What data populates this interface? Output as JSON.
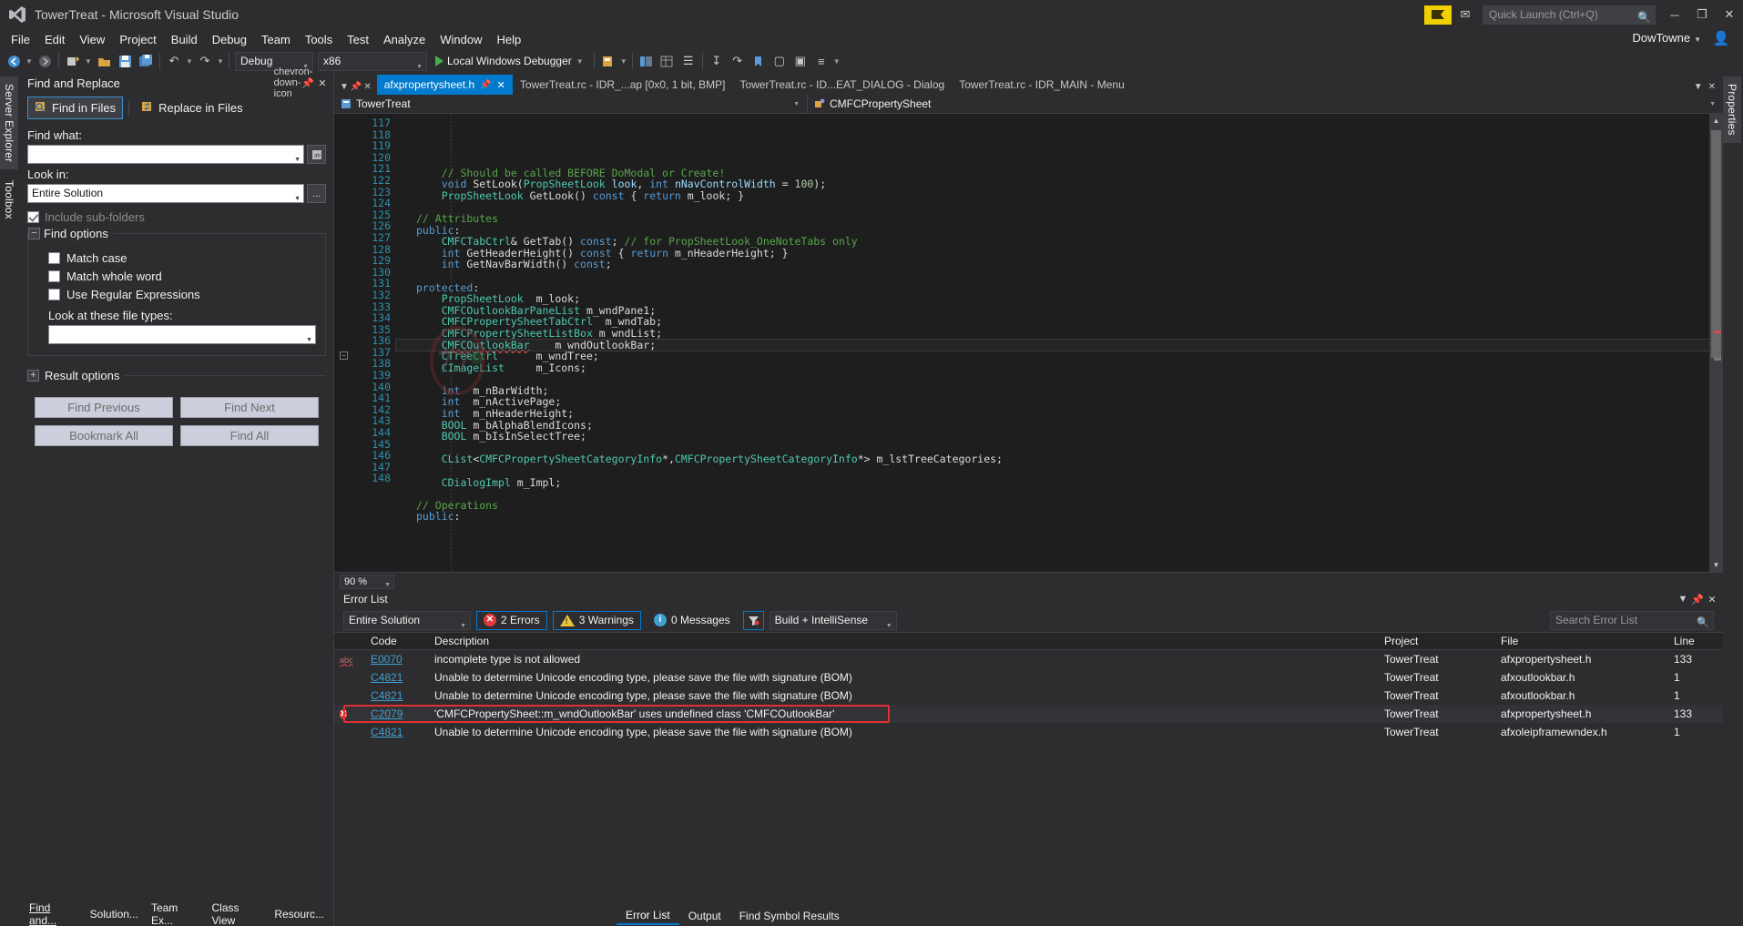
{
  "window": {
    "title": "TowerTreat - Microsoft Visual Studio",
    "logo_icon": "visual-studio-logo",
    "minimize_label": "─",
    "maximize_label": "❐",
    "close_label": "✕",
    "feedback_icon": "feedback-icon",
    "flag_icon": "flag-icon"
  },
  "quick_launch": {
    "placeholder": "Quick Launch (Ctrl+Q)",
    "icon": "search-icon"
  },
  "menu": {
    "items": [
      "File",
      "Edit",
      "View",
      "Project",
      "Build",
      "Debug",
      "Team",
      "Tools",
      "Test",
      "Analyze",
      "Window",
      "Help"
    ],
    "account": "DowTowne",
    "account_icon": "user-account-icon"
  },
  "toolbar": {
    "nav_back_icon": "navigate-back-icon",
    "nav_forward_icon": "navigate-forward-icon",
    "new_project_icon": "new-project-icon",
    "open_file_icon": "open-file-icon",
    "save_icon": "save-icon",
    "save_all_icon": "save-all-icon",
    "undo_icon": "undo-icon",
    "redo_icon": "redo-icon",
    "config": "Debug",
    "platform": "x86",
    "run_label": "Local Windows Debugger",
    "run_icon": "play-icon",
    "extra_icons": [
      "attach-icon",
      "solution-explorer-icon",
      "properties-icon",
      "toolbox-icon",
      "step-into-icon",
      "step-over-icon",
      "bookmark-icon",
      "comment-icon",
      "uncomment-icon",
      "indent-icon"
    ]
  },
  "left_rail": {
    "tabs": [
      "Server Explorer",
      "Toolbox"
    ]
  },
  "right_rail": {
    "tabs": [
      "Properties"
    ]
  },
  "find_replace": {
    "title": "Find and Replace",
    "pin_icon": "pin-icon",
    "close_icon": "close-icon",
    "chevron_icon": "chevron-down-icon",
    "tabs": [
      {
        "label": "Find in Files",
        "icon": "find-in-files-icon",
        "active": true
      },
      {
        "label": "Replace in Files",
        "icon": "replace-in-files-icon",
        "active": false
      }
    ],
    "find_what_label": "Find what:",
    "find_what_value": "",
    "find_what_button_icon": "regex-builder-icon",
    "look_in_label": "Look in:",
    "look_in_value": "Entire Solution",
    "look_in_browse": "...",
    "include_subfolders_label": "Include sub-folders",
    "include_subfolders_checked": true,
    "find_options_title": "Find options",
    "find_options_expander": "−",
    "options": [
      {
        "label": "Match case",
        "checked": false
      },
      {
        "label": "Match whole word",
        "checked": false
      },
      {
        "label": "Use Regular Expressions",
        "checked": false
      }
    ],
    "file_types_label": "Look at these file types:",
    "file_types_value": "",
    "result_options_title": "Result options",
    "result_options_expander": "+",
    "buttons": [
      "Find Previous",
      "Find Next",
      "Bookmark All",
      "Find All"
    ]
  },
  "footer_tabs": [
    "Find and...",
    "Solution...",
    "Team Ex...",
    "Class View",
    "Resourc..."
  ],
  "editor": {
    "tabs": [
      {
        "label": "afxpropertysheet.h",
        "active": true,
        "pin_icon": "pin-icon",
        "close_icon": "close-icon"
      },
      {
        "label": "TowerTreat.rc - IDR_...ap [0x0, 1 bit, BMP]",
        "active": false
      },
      {
        "label": "TowerTreat.rc - ID...EAT_DIALOG - Dialog",
        "active": false
      },
      {
        "label": "TowerTreat.rc - IDR_MAIN - Menu",
        "active": false
      }
    ],
    "tabstrip_left_icons": [
      "chevron-down-icon",
      "pin-icon",
      "close-icon"
    ],
    "tabstrip_right_icons": [
      "chevron-down-icon",
      "close-icon"
    ],
    "nav_left": {
      "label": "TowerTreat",
      "icon": "project-icon"
    },
    "nav_right": {
      "label": "CMFCPropertySheet",
      "icon": "class-icon"
    },
    "zoom": "90 %",
    "first_line": 117,
    "code_lines": [
      {
        "n": 117,
        "text": ""
      },
      {
        "n": 118,
        "text": "    // Should be called BEFORE DoModal or Create!",
        "cls": "cm"
      },
      {
        "n": 119,
        "html": "    <span class=\"kw\">void</span> SetLook(<span class=\"kw2\">PropSheetLook</span> <span class=\"id\">look</span>, <span class=\"kw\">int</span> <span class=\"id\">nNavControlWidth</span> = <span class=\"num\">100</span>);"
      },
      {
        "n": 120,
        "html": "    <span class=\"kw2\">PropSheetLook</span> GetLook() <span class=\"kw\">const</span> { <span class=\"kw\">return</span> m_look; }"
      },
      {
        "n": 121,
        "text": ""
      },
      {
        "n": 122,
        "html": "<span class=\"cm\">// Attributes</span>"
      },
      {
        "n": 123,
        "html": "<span class=\"kw\">public</span>:"
      },
      {
        "n": 124,
        "html": "    <span class=\"kw2\">CMFCTabCtrl</span>&amp; GetTab() <span class=\"kw\">const</span>; <span class=\"cm\">// for PropSheetLook_OneNoteTabs only</span>"
      },
      {
        "n": 125,
        "html": "    <span class=\"kw\">int</span> GetHeaderHeight() <span class=\"kw\">const</span> { <span class=\"kw\">return</span> m_nHeaderHeight; }"
      },
      {
        "n": 126,
        "html": "    <span class=\"kw\">int</span> GetNavBarWidth() <span class=\"kw\">const</span>;"
      },
      {
        "n": 127,
        "text": ""
      },
      {
        "n": 128,
        "html": "<span class=\"kw\">protected</span>:"
      },
      {
        "n": 129,
        "html": "    <span class=\"kw2\">PropSheetLook</span>  m_look;"
      },
      {
        "n": 130,
        "html": "    <span class=\"kw2\">CMFCOutlookBarPaneList</span> m_wndPane1;"
      },
      {
        "n": 131,
        "html": "    <span class=\"kw2\">CMFCPropertySheetTabCtrl</span>  m_wndTab;"
      },
      {
        "n": 132,
        "html": "    <span class=\"kw2\">CMFCPropertySheetListBox</span> m_wndList;"
      },
      {
        "n": 133,
        "html": "    <span class=\"kw2 squiggle\">CMFCOutlookBar</span>    m_wndOutlookBar;",
        "highlight": true
      },
      {
        "n": 134,
        "html": "    <span class=\"kw2\">CTreeCtrl</span>      m_wndTree;"
      },
      {
        "n": 135,
        "html": "    <span class=\"kw2\">CImageList</span>     m_Icons;"
      },
      {
        "n": 136,
        "text": ""
      },
      {
        "n": 137,
        "html": "    <span class=\"kw\">int</span>  m_nBarWidth;"
      },
      {
        "n": 138,
        "html": "    <span class=\"kw\">int</span>  m_nActivePage;"
      },
      {
        "n": 139,
        "html": "    <span class=\"kw\">int</span>  m_nHeaderHeight;"
      },
      {
        "n": 140,
        "html": "    <span class=\"kw2\">BOOL</span> m_bAlphaBlendIcons;"
      },
      {
        "n": 141,
        "html": "    <span class=\"kw2\">BOOL</span> m_bIsInSelectTree;"
      },
      {
        "n": 142,
        "text": ""
      },
      {
        "n": 143,
        "html": "    <span class=\"kw2\">CList</span>&lt;<span class=\"kw2\">CMFCPropertySheetCategoryInfo</span>*,<span class=\"kw2\">CMFCPropertySheetCategoryInfo</span>*&gt; m_lstTreeCategories;"
      },
      {
        "n": 144,
        "text": ""
      },
      {
        "n": 145,
        "html": "    <span class=\"kw2\">CDialogImpl</span> m_Impl;"
      },
      {
        "n": 146,
        "text": ""
      },
      {
        "n": 147,
        "html": "<span class=\"cm\">// Operations</span>"
      },
      {
        "n": 148,
        "html": "<span class=\"kw\">public</span>:"
      }
    ]
  },
  "error_list": {
    "title": "Error List",
    "pin_icon": "pin-icon",
    "close_icon": "close-icon",
    "chevron_icon": "chevron-down-icon",
    "scope": "Entire Solution",
    "errors_count": "2 Errors",
    "warnings_count": "3 Warnings",
    "messages_count": "0 Messages",
    "filter_icon": "filter-icon",
    "build_filter": "Build + IntelliSense",
    "search_placeholder": "Search Error List",
    "search_icon": "search-icon",
    "columns": [
      "",
      "Code",
      "Description",
      "Project",
      "File",
      "Line"
    ],
    "rows": [
      {
        "icon": "abc-squiggle-icon",
        "code": "E0070",
        "description": "incomplete type is not allowed",
        "project": "TowerTreat",
        "file": "afxpropertysheet.h",
        "line": "133",
        "selected": false,
        "highlighted": false
      },
      {
        "icon": "warning-icon",
        "code": "C4821",
        "description": "Unable to determine Unicode encoding type, please save the file with signature (BOM)",
        "project": "TowerTreat",
        "file": "afxoutlookbar.h",
        "line": "1",
        "selected": false,
        "highlighted": false
      },
      {
        "icon": "warning-icon",
        "code": "C4821",
        "description": "Unable to determine Unicode encoding type, please save the file with signature (BOM)",
        "project": "TowerTreat",
        "file": "afxoutlookbar.h",
        "line": "1",
        "selected": false,
        "highlighted": false
      },
      {
        "icon": "error-icon",
        "code": "C2079",
        "description": "'CMFCPropertySheet::m_wndOutlookBar' uses undefined class 'CMFCOutlookBar'",
        "project": "TowerTreat",
        "file": "afxpropertysheet.h",
        "line": "133",
        "selected": true,
        "highlighted": true
      },
      {
        "icon": "warning-icon",
        "code": "C4821",
        "description": "Unable to determine Unicode encoding type, please save the file with signature (BOM)",
        "project": "TowerTreat",
        "file": "afxoleipframewndex.h",
        "line": "1",
        "selected": false,
        "highlighted": false
      }
    ]
  },
  "bottom_tabs": [
    {
      "label": "Error List",
      "active": true
    },
    {
      "label": "Output",
      "active": false
    },
    {
      "label": "Find Symbol Results",
      "active": false
    }
  ],
  "colors": {
    "accent": "#007acc",
    "background": "#2d2d30",
    "editor_bg": "#1e1e1e",
    "error": "#e03b3b",
    "warning": "#e8c33a",
    "info": "#3f9fd0",
    "link": "#3f9fd0"
  }
}
